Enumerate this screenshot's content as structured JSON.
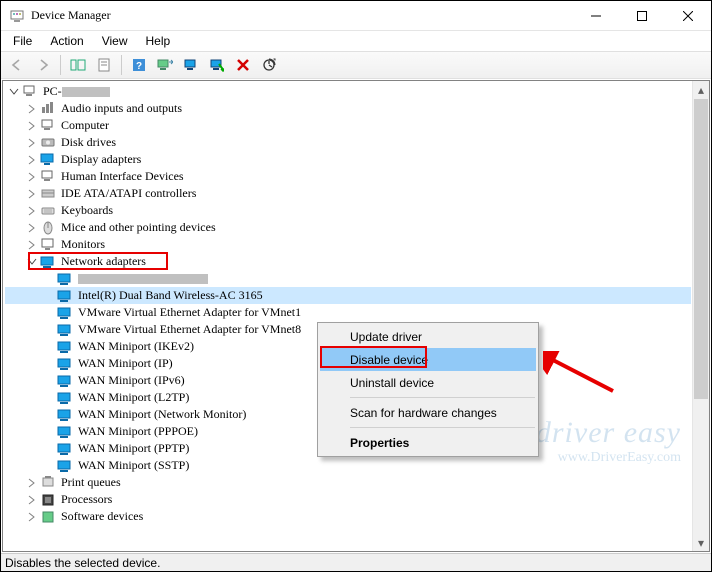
{
  "window": {
    "title": "Device Manager"
  },
  "menus": {
    "file": "File",
    "action": "Action",
    "view": "View",
    "help": "Help"
  },
  "toolbar_icons": {
    "back": "back-arrow",
    "forward": "forward-arrow",
    "up": "show-hide-tree",
    "help": "help",
    "action": "action",
    "monitor": "monitor",
    "scan": "scan-hardware",
    "disable": "disable",
    "uninstall": "uninstall"
  },
  "tree": {
    "root": "PC-",
    "categories": [
      "Audio inputs and outputs",
      "Computer",
      "Disk drives",
      "Display adapters",
      "Human Interface Devices",
      "IDE ATA/ATAPI controllers",
      "Keyboards",
      "Mice and other pointing devices",
      "Monitors",
      "Network adapters",
      "Print queues",
      "Processors",
      "Software devices"
    ],
    "network_adapters": [
      "",
      "Intel(R) Dual Band Wireless-AC 3165",
      "VMware Virtual Ethernet Adapter for VMnet1",
      "VMware Virtual Ethernet Adapter for VMnet8",
      "WAN Miniport (IKEv2)",
      "WAN Miniport (IP)",
      "WAN Miniport (IPv6)",
      "WAN Miniport (L2TP)",
      "WAN Miniport (Network Monitor)",
      "WAN Miniport (PPPOE)",
      "WAN Miniport (PPTP)",
      "WAN Miniport (SSTP)"
    ]
  },
  "context_menu": {
    "update": "Update driver",
    "disable": "Disable device",
    "uninstall": "Uninstall device",
    "scan": "Scan for hardware changes",
    "properties": "Properties"
  },
  "status": "Disables the selected device.",
  "watermark": {
    "brand": "driver easy",
    "url": "www.DriverEasy.com"
  }
}
